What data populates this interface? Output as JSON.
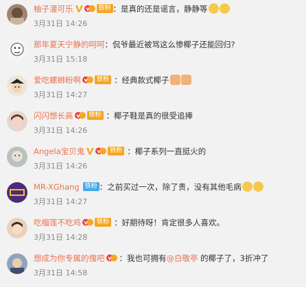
{
  "badge_text": "铁粉",
  "comments": [
    {
      "username": "柚子灌可乐",
      "text": "：是真的还是谣言，静静等",
      "time": "3月31日 14:26",
      "avatar_color": "#8a6e5a"
    },
    {
      "username": "那年夏天宁静的呵呵",
      "text": "：侃爷最近被骂这么惨椰子还能回归?",
      "time": "3月31日 15:18",
      "avatar_color": "#dddddd"
    },
    {
      "username": "爱吃螺蛳粉啊",
      "text": "：经典款式椰子",
      "time": "3月31日 14:27",
      "avatar_color": "#e8d8c8"
    },
    {
      "username": "闪闪想长高",
      "text": "：椰子鞋是真的很受追捧",
      "time": "3月31日 14:26",
      "avatar_color": "#c9a89a"
    },
    {
      "username": "Angela宝贝鬼",
      "text": "：椰子系列一直挺火的",
      "time": "3月31日 14:26",
      "avatar_color": "#9aa7a0"
    },
    {
      "username": "MR-XGhang",
      "text": "：之前买过一次，除了贵，没有其他毛病",
      "time": "3月31日 14:27",
      "avatar_color": "#4b2a7a"
    },
    {
      "username": "吃榴莲不吃鸡",
      "text": "：好期待呀！肯定很多人喜欢。",
      "time": "3月31日 14:28",
      "avatar_color": "#c88a60"
    },
    {
      "username": "想成为你专属的傀吧",
      "text_before": "：我也可拥有",
      "mention": "@白敬亭",
      "text_after": " 的椰子了，3折冲了",
      "time": "3月31日 14:58",
      "avatar_color": "#6a7fa0"
    }
  ]
}
